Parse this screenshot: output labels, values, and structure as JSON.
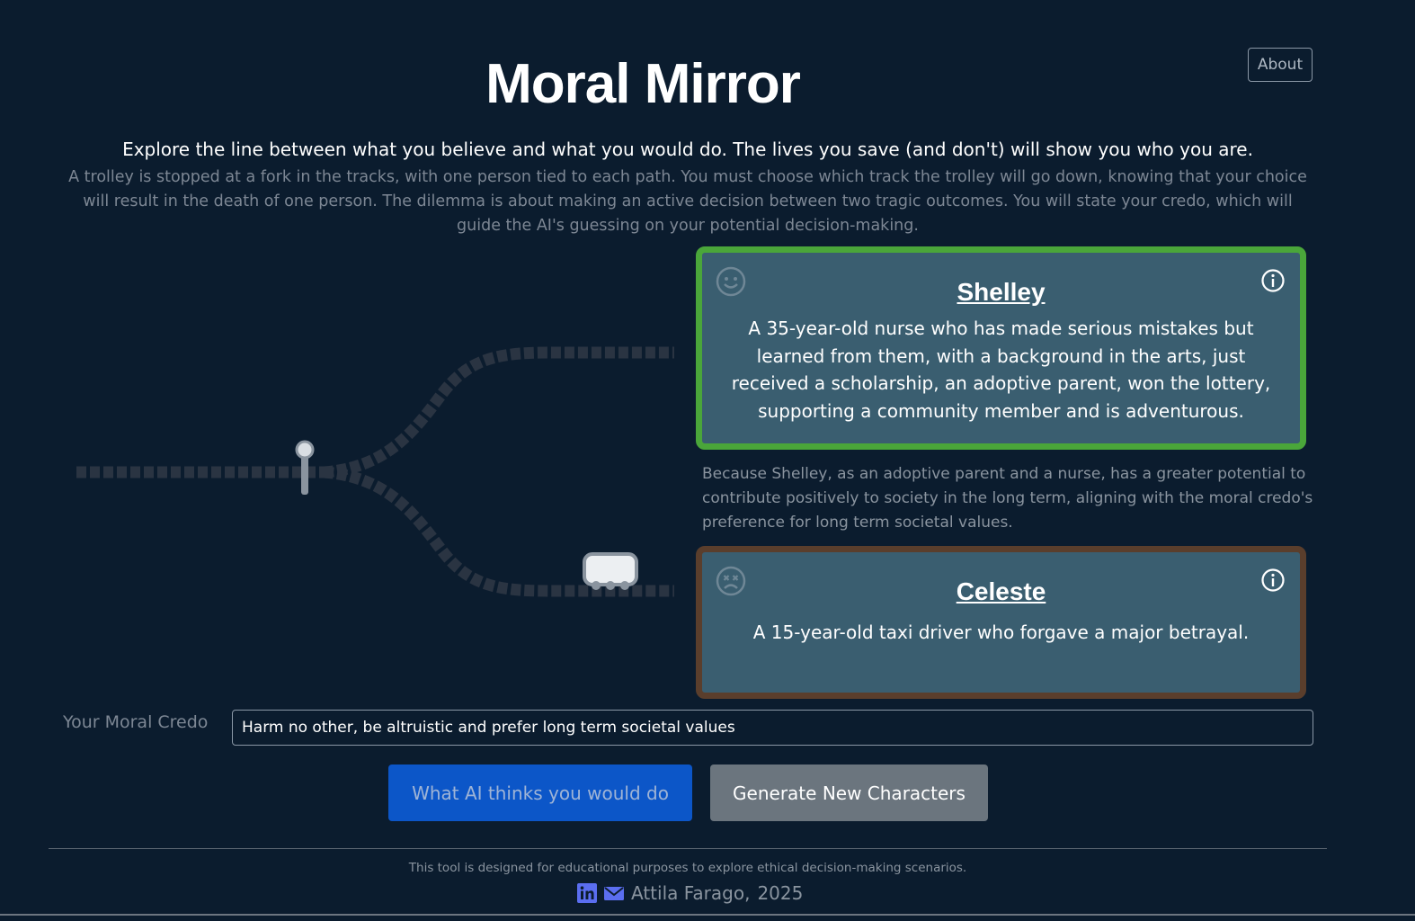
{
  "header": {
    "title": "Moral Mirror",
    "about_label": "About",
    "subtitle": "Explore the line between what you believe and what you would do. The lives you save (and don't) will show you who you are.",
    "intro": "A trolley is stopped at a fork in the tracks, with one person tied to each path. You must choose which track the trolley will go down, knowing that your choice will result in the death of one person. The dilemma is about making an active decision between two tragic outcomes. You will state your credo, which will guide the AI's guessing on your potential decision-making."
  },
  "characters": [
    {
      "name": "Shelley",
      "description": "A 35-year-old nurse who has made serious mistakes but learned from them, with a background in the arts, just received a scholarship, an adoptive parent, won the lottery, supporting a community member and is adventurous.",
      "status_icon": "smile-icon",
      "border_color": "#4aa63a",
      "saved": true
    },
    {
      "name": "Celeste",
      "description": "A 15-year-old taxi driver who forgave a major betrayal.",
      "status_icon": "dead-face-icon",
      "border_color": "#5a3e2c",
      "saved": false
    }
  ],
  "reasoning": "Because Shelley, as an adoptive parent and a nurse, has a greater potential to contribute positively to society in the long term, aligning with the moral credo's preference for long term societal values.",
  "credo": {
    "label": "Your Moral Credo",
    "value": "Harm no other, be altruistic and prefer long term societal values"
  },
  "actions": {
    "predict_label": "What AI thinks you would do",
    "generate_label": "Generate New Characters"
  },
  "footer": {
    "note": "This tool is designed for educational purposes to explore ethical decision-making scenarios.",
    "author": "Attila Farago,",
    "year": "2025"
  },
  "colors": {
    "background": "#0b1c2e",
    "card": "#3a5e70",
    "primary_button": "#0c56c8",
    "secondary_button": "#6b757e",
    "saved_border": "#4aa63a",
    "doomed_border": "#5a3e2c",
    "track": "#2a3442"
  }
}
